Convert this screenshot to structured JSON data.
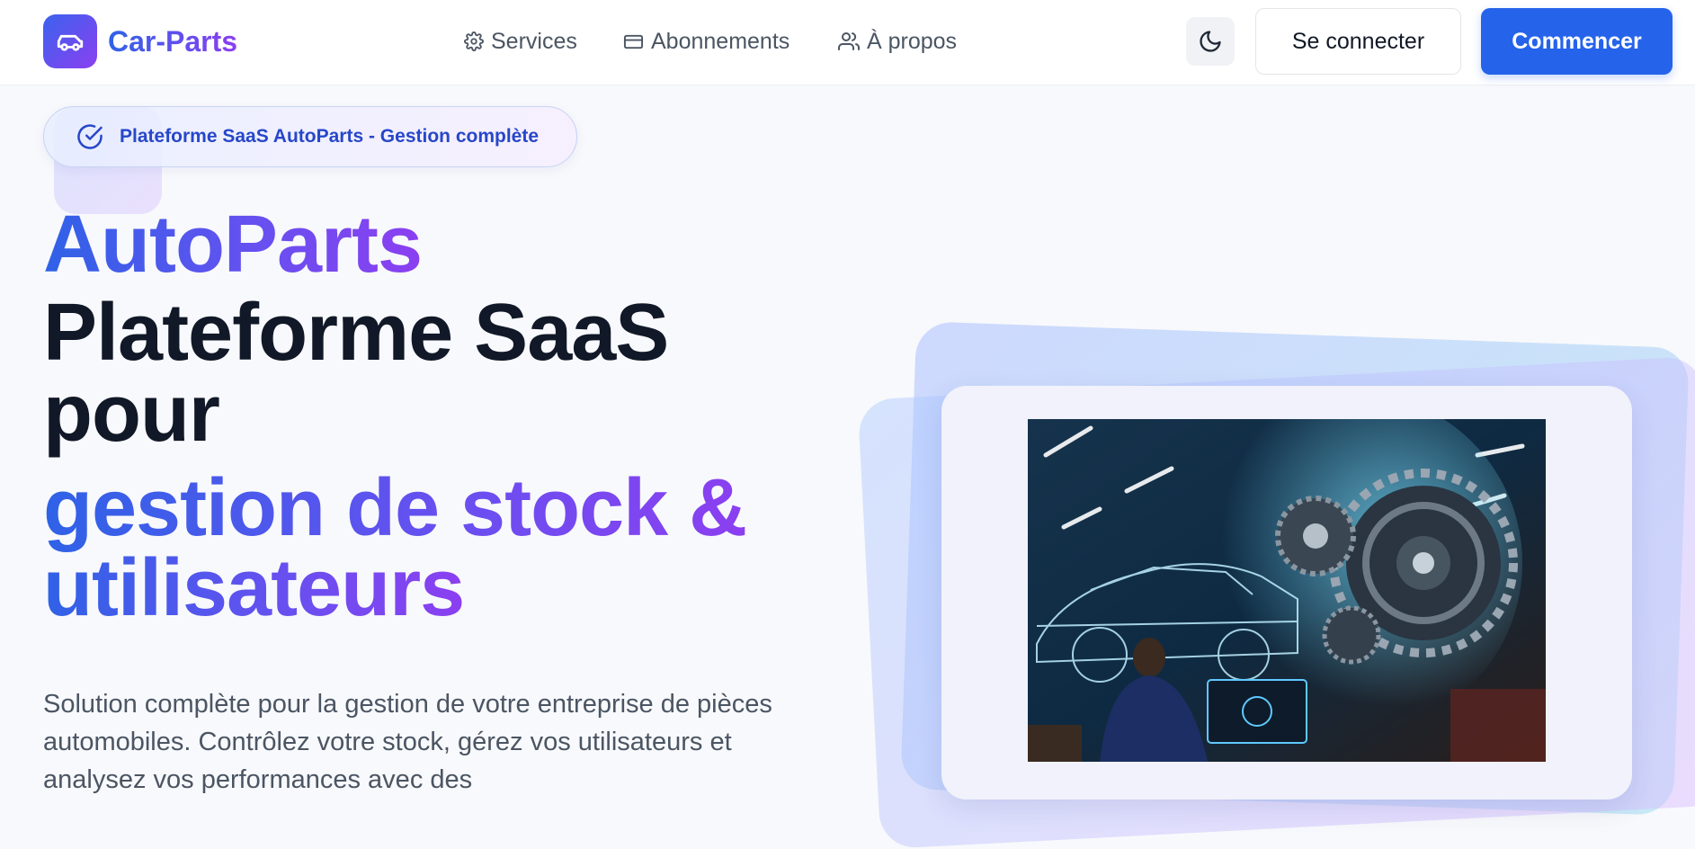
{
  "brand": {
    "name": "Car-Parts",
    "icon": "car-icon"
  },
  "nav": [
    {
      "label": "Services",
      "icon": "gear-icon"
    },
    {
      "label": "Abonnements",
      "icon": "credit-card-icon"
    },
    {
      "label": "À propos",
      "icon": "users-icon"
    }
  ],
  "actions": {
    "theme_icon": "moon-icon",
    "login_label": "Se connecter",
    "start_label": "Commencer"
  },
  "hero": {
    "badge": "Plateforme SaaS AutoParts - Gestion complète",
    "badge_icon": "check-circle-icon",
    "title_line1": "AutoParts",
    "title_line2": "Plateforme SaaS",
    "title_line3": "pour",
    "title_line4": "gestion de stock &",
    "title_line5": "utilisateurs",
    "description": "Solution complète pour la gestion de votre entreprise de pièces automobiles. Contrôlez votre stock, gérez vos utilisateurs et analysez vos performances avec des"
  },
  "colors": {
    "accent": "#2563eb",
    "gradient_start": "#2f62e7",
    "gradient_end": "#8b3ff0",
    "text_dark": "#111827",
    "text_muted": "#4b5563"
  }
}
